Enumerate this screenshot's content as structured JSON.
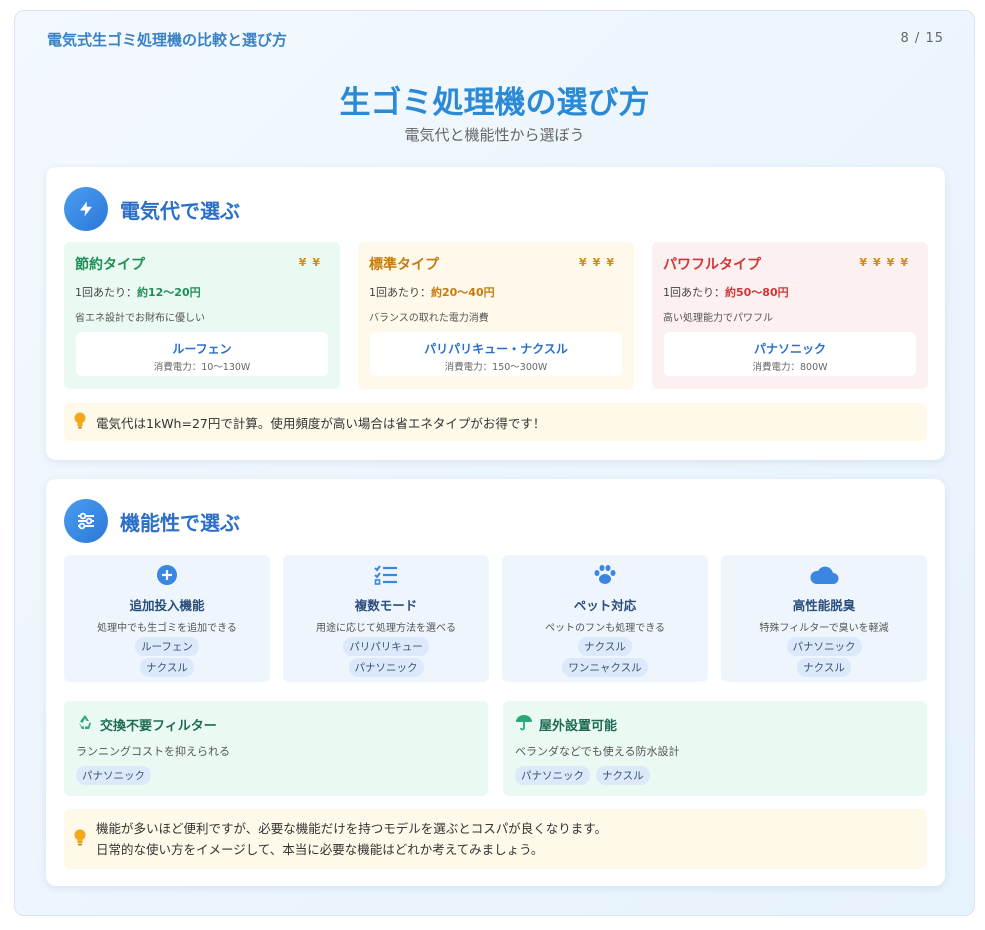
{
  "header": {
    "title": "電気式生ゴミ処理機の比較と選び方",
    "page": "8 / 15"
  },
  "main": {
    "title": "生ゴミ処理機の選び方",
    "subtitle": "電気代と機能性から選ぼう"
  },
  "section_cost": {
    "title": "電気代で選ぶ",
    "icon": "bolt-icon",
    "types": [
      {
        "name": "節約タイプ",
        "yen": "¥¥",
        "cost_prefix": "1回あたり：",
        "cost_value": "約12〜20円",
        "desc": "省エネ設計でお財布に優しい",
        "model": "ルーフェン",
        "power": "消費電力：10〜130W",
        "color": "#1f8f55"
      },
      {
        "name": "標準タイプ",
        "yen": "¥¥¥",
        "cost_prefix": "1回あたり：",
        "cost_value": "約20〜40円",
        "desc": "バランスの取れた電力消費",
        "model": "パリパリキュー・ナクスル",
        "power": "消費電力：150〜300W",
        "color": "#c9790b"
      },
      {
        "name": "パワフルタイプ",
        "yen": "¥¥¥¥",
        "cost_prefix": "1回あたり：",
        "cost_value": "約50〜80円",
        "desc": "高い処理能力でパワフル",
        "model": "パナソニック",
        "power": "消費電力：800W",
        "color": "#d23636"
      }
    ],
    "tip": "電気代は1kWh=27円で計算。使用頻度が高い場合は省エネタイプがお得です！"
  },
  "section_function": {
    "title": "機能性で選ぶ",
    "icon": "sliders-icon",
    "features": [
      {
        "name": "追加投入機能",
        "desc": "処理中でも生ゴミを追加できる",
        "tags": [
          "ルーフェン",
          "ナクスル"
        ],
        "icon": "plus-circle-icon"
      },
      {
        "name": "複数モード",
        "desc": "用途に応じて処理方法を選べる",
        "tags": [
          "パリパリキュー",
          "パナソニック"
        ],
        "icon": "list-check-icon"
      },
      {
        "name": "ペット対応",
        "desc": "ペットのフンも処理できる",
        "tags": [
          "ナクスル",
          "ワンニャクスル"
        ],
        "icon": "paw-icon"
      },
      {
        "name": "高性能脱臭",
        "desc": "特殊フィルターで臭いを軽減",
        "tags": [
          "パナソニック",
          "ナクスル"
        ],
        "icon": "cloud-icon"
      }
    ],
    "wide": [
      {
        "name": "交換不要フィルター",
        "desc": "ランニングコストを抑えられる",
        "tags": [
          "パナソニック"
        ],
        "icon": "recycle-icon"
      },
      {
        "name": "屋外設置可能",
        "desc": "ベランダなどでも使える防水設計",
        "tags": [
          "パナソニック",
          "ナクスル"
        ],
        "icon": "umbrella-icon"
      }
    ],
    "tip_lines": [
      "機能が多いほど便利ですが、必要な機能だけを持つモデルを選ぶとコスパが良くなります。",
      "日常的な使い方をイメージして、本当に必要な機能はどれか考えてみましょう。"
    ]
  },
  "colors": {
    "accent": "#2b8ad6",
    "heading": "#2b6fc8",
    "tip_bg": "#fef9e8"
  }
}
